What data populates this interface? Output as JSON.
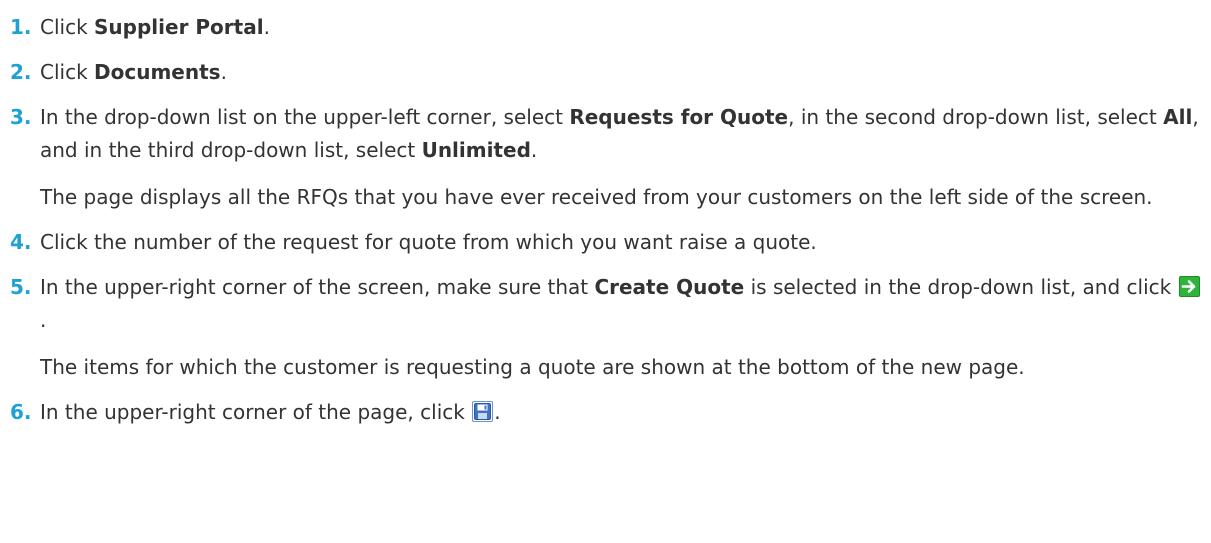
{
  "steps": [
    {
      "num": "1.",
      "parts": [
        {
          "t": "Click "
        },
        {
          "b": "Supplier Portal"
        },
        {
          "t": "."
        }
      ]
    },
    {
      "num": "2.",
      "parts": [
        {
          "t": "Click "
        },
        {
          "b": "Documents"
        },
        {
          "t": "."
        }
      ]
    },
    {
      "num": "3.",
      "parts": [
        {
          "t": "In the drop-down list on the upper-left corner, select "
        },
        {
          "b": "Requests for Quote"
        },
        {
          "t": ", in the second drop-down list, select "
        },
        {
          "b": "All"
        },
        {
          "t": ", and in the third drop-down list, select "
        },
        {
          "b": "Unlimited"
        },
        {
          "t": "."
        }
      ],
      "note": "The page displays all the RFQs that you have ever received from your customers on the left side of the screen."
    },
    {
      "num": "4.",
      "parts": [
        {
          "t": "Click the number of the request for quote from which you want raise a quote."
        }
      ]
    },
    {
      "num": "5.",
      "parts": [
        {
          "t": "In the upper-right corner of the screen, make sure that "
        },
        {
          "b": "Create Quote"
        },
        {
          "t": " is selected in the drop-down list, and click "
        },
        {
          "icon": "go-arrow-icon"
        },
        {
          "t": "."
        }
      ],
      "note": "The items for which the customer is requesting a quote are shown at the bottom of the new page."
    },
    {
      "num": "6.",
      "parts": [
        {
          "t": "In the upper-right corner of the page, click "
        },
        {
          "icon": "save-disk-icon"
        },
        {
          "t": "."
        }
      ]
    }
  ],
  "colors": {
    "step_number": "#1fa1d3",
    "text": "#333333",
    "go_icon": "#2fb33b",
    "save_icon_border": "#6b93c6"
  }
}
